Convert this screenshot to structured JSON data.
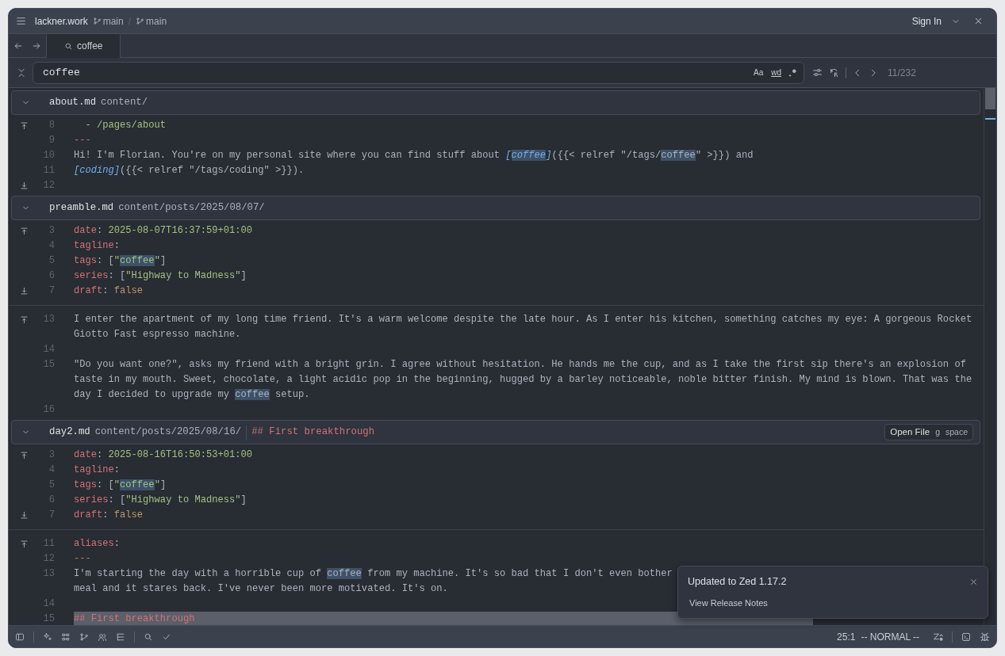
{
  "title_bar": {
    "project": "lackner.work",
    "branches": [
      "main",
      "main"
    ],
    "separator": "/",
    "sign_in": "Sign In"
  },
  "tabs": [
    {
      "label": "coffee",
      "selected": true
    }
  ],
  "search": {
    "value": "coffee",
    "options": [
      "Aa",
      "wd"
    ],
    "counter": "11/232"
  },
  "excerpts": [
    {
      "filename": "about.md",
      "path": "content/",
      "hunks": [
        [
          {
            "num": "8",
            "expand_up": true,
            "segs": [
              {
                "kind": "punct",
                "text": "  - "
              },
              {
                "kind": "str",
                "text": "/pages/about"
              }
            ]
          },
          {
            "num": "9",
            "segs": [
              {
                "kind": "key",
                "text": "---"
              }
            ]
          },
          {
            "num": "10",
            "segs": [
              {
                "kind": "text",
                "text": "Hi! I'm Florian. You're on my personal site where you can find stuff about "
              },
              {
                "kind": "link",
                "text": "["
              },
              {
                "kind": "link_match",
                "text": "coffee"
              },
              {
                "kind": "link",
                "text": "]"
              },
              {
                "kind": "text",
                "text": "({{< relref \"/tags/"
              },
              {
                "kind": "match",
                "text": "coffee"
              },
              {
                "kind": "text",
                "text": "\" >}}) and"
              }
            ]
          },
          {
            "num": "11",
            "segs": [
              {
                "kind": "link",
                "text": "[coding]"
              },
              {
                "kind": "text",
                "text": "({{< relref \"/tags/coding\" >}})."
              }
            ]
          },
          {
            "num": "12",
            "expand_down": true
          }
        ]
      ]
    },
    {
      "filename": "preamble.md",
      "path": "content/posts/2025/08/07/",
      "hunks": [
        [
          {
            "num": "3",
            "expand_up": true,
            "segs": [
              {
                "kind": "key",
                "text": "date"
              },
              {
                "kind": "punct",
                "text": ": "
              },
              {
                "kind": "str",
                "text": "2025-08-07T16:37:59+01:00"
              }
            ]
          },
          {
            "num": "4",
            "segs": [
              {
                "kind": "key",
                "text": "tagline"
              },
              {
                "kind": "punct",
                "text": ":"
              }
            ]
          },
          {
            "num": "5",
            "segs": [
              {
                "kind": "key",
                "text": "tags"
              },
              {
                "kind": "punct",
                "text": ": ["
              },
              {
                "kind": "str",
                "text": "\""
              },
              {
                "kind": "str_match",
                "text": "coffee"
              },
              {
                "kind": "str",
                "text": "\""
              },
              {
                "kind": "punct",
                "text": "]"
              }
            ]
          },
          {
            "num": "6",
            "segs": [
              {
                "kind": "key",
                "text": "series"
              },
              {
                "kind": "punct",
                "text": ": ["
              },
              {
                "kind": "str",
                "text": "\"Highway to Madness\""
              },
              {
                "kind": "punct",
                "text": "]"
              }
            ]
          },
          {
            "num": "7",
            "expand_down": true,
            "segs": [
              {
                "kind": "key",
                "text": "draft"
              },
              {
                "kind": "punct",
                "text": ": "
              },
              {
                "kind": "bool",
                "text": "false"
              }
            ]
          }
        ],
        [
          {
            "num": "13",
            "expand_up": true,
            "segs": [
              {
                "kind": "text",
                "text": "I enter the apartment of my long time friend. It's a warm welcome despite the late hour. As I enter his kitchen, something catches my eye: A gorgeous Rocket"
              }
            ]
          },
          {
            "segs": [
              {
                "kind": "text",
                "text": "Giotto Fast espresso machine."
              }
            ]
          },
          {
            "num": "14"
          },
          {
            "num": "15",
            "segs": [
              {
                "kind": "text",
                "text": "\"Do you want one?\", asks my friend with a bright grin. I agree without hesitation. He hands me the cup, and as I take the first sip there's an explosion of"
              }
            ]
          },
          {
            "segs": [
              {
                "kind": "text",
                "text": "taste in my mouth. Sweet, chocolate, a light acidic pop in the beginning, hugged by a barley noticeable, noble bitter finish. My mind is blown. That was the"
              }
            ]
          },
          {
            "segs": [
              {
                "kind": "text",
                "text": "day I decided to upgrade my "
              },
              {
                "kind": "match",
                "text": "coffee"
              },
              {
                "kind": "text",
                "text": " setup."
              }
            ]
          },
          {
            "num": "16"
          }
        ]
      ]
    },
    {
      "filename": "day2.md",
      "path": "content/posts/2025/08/16/",
      "heading": "## First breakthrough",
      "open_file": {
        "label": "Open File",
        "keys": [
          "g",
          "space"
        ]
      },
      "hunks": [
        [
          {
            "num": "3",
            "expand_up": true,
            "segs": [
              {
                "kind": "key",
                "text": "date"
              },
              {
                "kind": "punct",
                "text": ": "
              },
              {
                "kind": "str",
                "text": "2025-08-16T16:50:53+01:00"
              }
            ]
          },
          {
            "num": "4",
            "segs": [
              {
                "kind": "key",
                "text": "tagline"
              },
              {
                "kind": "punct",
                "text": ":"
              }
            ]
          },
          {
            "num": "5",
            "segs": [
              {
                "kind": "key",
                "text": "tags"
              },
              {
                "kind": "punct",
                "text": ": ["
              },
              {
                "kind": "str",
                "text": "\""
              },
              {
                "kind": "str_match",
                "text": "coffee"
              },
              {
                "kind": "str",
                "text": "\""
              },
              {
                "kind": "punct",
                "text": "]"
              }
            ]
          },
          {
            "num": "6",
            "segs": [
              {
                "kind": "key",
                "text": "series"
              },
              {
                "kind": "punct",
                "text": ": ["
              },
              {
                "kind": "str",
                "text": "\"Highway to Madness\""
              },
              {
                "kind": "punct",
                "text": "]"
              }
            ]
          },
          {
            "num": "7",
            "expand_down": true,
            "segs": [
              {
                "kind": "key",
                "text": "draft"
              },
              {
                "kind": "punct",
                "text": ": "
              },
              {
                "kind": "bool",
                "text": "false"
              }
            ]
          }
        ],
        [
          {
            "num": "11",
            "expand_up": true,
            "segs": [
              {
                "kind": "key",
                "text": "aliases"
              },
              {
                "kind": "punct",
                "text": ":"
              }
            ]
          },
          {
            "num": "12",
            "segs": [
              {
                "kind": "key",
                "text": "---"
              }
            ]
          },
          {
            "num": "13",
            "segs": [
              {
                "kind": "text",
                "text": "I'm starting the day with a horrible cup of "
              },
              {
                "kind": "match",
                "text": "coffee"
              },
              {
                "kind": "text",
                "text": " from my machine. It's so bad that I don't even bother"
              }
            ]
          },
          {
            "segs": [
              {
                "kind": "text",
                "text": "meal and it stares back. I've never been more motivated. It's on."
              }
            ]
          },
          {
            "num": "14"
          },
          {
            "num": "15",
            "highlighted": true,
            "segs": [
              {
                "kind": "key",
                "text": "## First breakthrough"
              }
            ]
          }
        ]
      ]
    }
  ],
  "toast": {
    "title": "Updated to Zed 1.17.2",
    "action": "View Release Notes"
  },
  "status_bar": {
    "position": "25:1",
    "mode": "-- NORMAL --"
  }
}
